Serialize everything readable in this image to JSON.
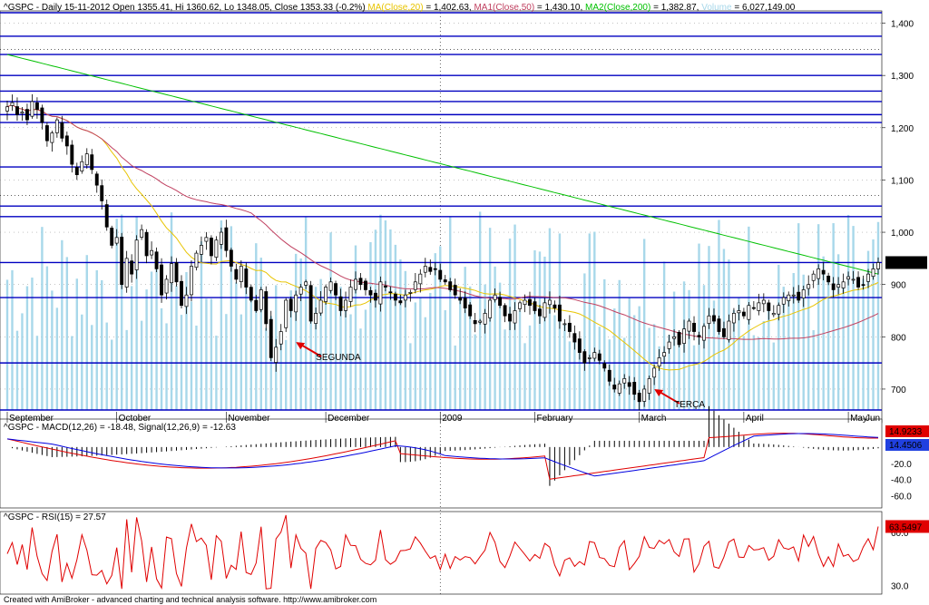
{
  "header": {
    "prefix": "^GSPC - Daily 15-11-2012 Open 1355.41, Hi 1360.62, Lo 1348.05, Close 1353.33 (-0.2%) ",
    "ma": "MA(Close,20)",
    "ma_val": " = 1,402.63, ",
    "ma1": "MA1(Close,50)",
    "ma1_val": " = 1,430.10, ",
    "ma2": "MA2(Close,200)",
    "ma2_val": " = 1,382.87, ",
    "vol": "Volume",
    "vol_val": " = 6,027,149.00"
  },
  "footer": "Created with AmiBroker - advanced charting and technical analysis software. http://www.amibroker.com",
  "colors": {
    "ma20": "#e8c400",
    "ma50": "#c04060",
    "ma200": "#00c000",
    "macd": "#e00000",
    "signal": "#0000e0",
    "rsi": "#e00000",
    "volume": "#a8d8ea",
    "hline": "#0000c0"
  },
  "annotations": [
    {
      "text": "SEGUNDA",
      "date_index": 58,
      "price": 790
    },
    {
      "text": "TERÇA",
      "date_index": 130,
      "price": 700
    }
  ],
  "chart_data": [
    {
      "type": "candlestick",
      "title": "^GSPC - Daily",
      "xlabel": "",
      "ylabel": "",
      "x_ticks": [
        "September",
        "October",
        "November",
        "December",
        "2009",
        "February",
        "March",
        "April",
        "May",
        "Jun"
      ],
      "x_tick_index": [
        0,
        22,
        44,
        64,
        87,
        106,
        127,
        148,
        169,
        190
      ],
      "y_ticks": [
        700,
        800,
        900,
        1000,
        1100,
        1200,
        1300,
        1400
      ],
      "ylim": [
        660,
        1420
      ],
      "price_lines": [
        1420,
        1375,
        1340,
        1300,
        1270,
        1250,
        1225,
        1210,
        1125,
        1050,
        1030,
        942,
        875,
        750,
        660
      ],
      "dashed_lines": [
        1350,
        1070
      ],
      "last_close": "942.87",
      "closes": [
        1240,
        1248,
        1225,
        1230,
        1215,
        1250,
        1235,
        1210,
        1175,
        1190,
        1215,
        1180,
        1165,
        1130,
        1110,
        1135,
        1150,
        1120,
        1090,
        1060,
        1010,
        975,
        990,
        900,
        950,
        920,
        985,
        1005,
        955,
        965,
        930,
        880,
        910,
        940,
        905,
        860,
        880,
        935,
        960,
        975,
        990,
        955,
        985,
        1000,
        965,
        935,
        910,
        935,
        895,
        870,
        850,
        890,
        825,
        760,
        780,
        810,
        870,
        850,
        880,
        895,
        905,
        830,
        845,
        870,
        895,
        905,
        880,
        850,
        870,
        895,
        910,
        900,
        890,
        880,
        870,
        905,
        895,
        885,
        870,
        865,
        880,
        885,
        905,
        920,
        935,
        925,
        930,
        910,
        905,
        890,
        880,
        870,
        855,
        840,
        825,
        830,
        845,
        870,
        880,
        860,
        840,
        830,
        850,
        865,
        870,
        860,
        850,
        840,
        865,
        870,
        855,
        830,
        825,
        810,
        790,
        770,
        750,
        760,
        770,
        755,
        740,
        715,
        700,
        710,
        720,
        705,
        690,
        676,
        700,
        720,
        740,
        760,
        770,
        790,
        800,
        785,
        815,
        830,
        810,
        800,
        820,
        840,
        830,
        810,
        800,
        830,
        845,
        850,
        840,
        860,
        855,
        865,
        870,
        850,
        845,
        860,
        875,
        880,
        880,
        870,
        890,
        900,
        920,
        930,
        920,
        905,
        890,
        900,
        905,
        915,
        910,
        895,
        900,
        920,
        930,
        942
      ]
    },
    {
      "type": "line",
      "title": "^GSPC - MACD(12,26) = -18.48, Signal(12,26,9) = -12.63",
      "series": [
        {
          "name": "MACD(12,26)",
          "values_note": "oscillator"
        },
        {
          "name": "Signal(12,26,9)",
          "values_note": "oscillator"
        }
      ],
      "y_ticks": [
        -20,
        -40,
        -60
      ],
      "ylim": [
        -75,
        30
      ],
      "last_macd": "14.9233",
      "last_signal": "14.4506"
    },
    {
      "type": "line",
      "title": "^GSPC - RSI(15) = 27.57",
      "series": [
        {
          "name": "RSI(15)"
        }
      ],
      "y_ticks": [
        60,
        30
      ],
      "ylim": [
        25,
        72
      ],
      "last_value": "63.5497"
    }
  ]
}
